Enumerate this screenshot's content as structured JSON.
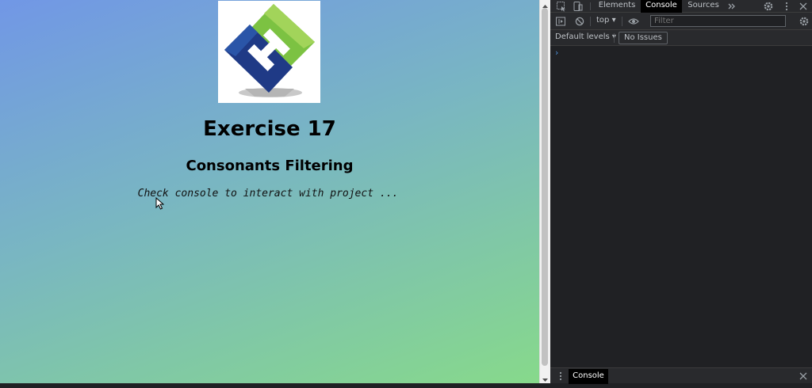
{
  "page": {
    "title": "Exercise 17",
    "subtitle": "Consonants Filtering",
    "hint": "Check console to interact with project ..."
  },
  "devtools": {
    "tabs": [
      "Elements",
      "Console",
      "Sources"
    ],
    "active_tab": "Console",
    "context": "top",
    "filter_placeholder": "Filter",
    "levels": "Default levels",
    "issues": "No Issues",
    "prompt": "›",
    "drawer_tab": "Console"
  },
  "colors": {
    "gradient_start": "#7197e6",
    "gradient_end": "#87d98b",
    "devtools_bg": "#202124",
    "logo_dark_blue": "#1f3a86",
    "logo_green": "#7cc242"
  },
  "icons": [
    "inspect-icon",
    "device-toolbar-icon",
    "more-tabs-icon",
    "settings-icon",
    "kebab-menu-icon",
    "close-icon",
    "sidebar-toggle-icon",
    "clear-console-icon",
    "dropdown-arrow-icon",
    "eye-icon",
    "console-settings-icon",
    "drawer-menu-icon",
    "mouse-cursor-icon"
  ]
}
